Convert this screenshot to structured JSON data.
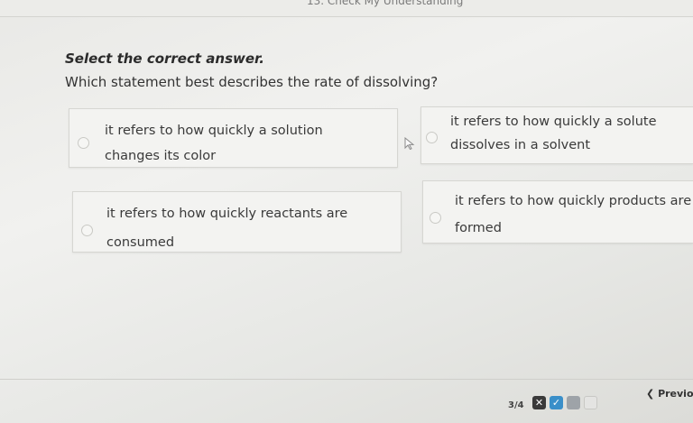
{
  "header": {
    "title": "13. Check My Understanding"
  },
  "instruction": "Select the correct answer.",
  "question": "Which statement best describes the rate of dissolving?",
  "options": [
    {
      "line1": "it refers to how quickly a solution",
      "line2": "changes its color"
    },
    {
      "line1": "it refers to how quickly a solute",
      "line2": "dissolves in a solvent"
    },
    {
      "line1": "it refers to how quickly reactants are",
      "line2": "consumed"
    },
    {
      "line1": "it refers to how quickly products are",
      "line2": "formed"
    }
  ],
  "footer": {
    "page_indicator": "3/4",
    "nav_wrong_icon": "x-icon",
    "nav_wrong_glyph": "✕",
    "nav_correct_icon": "check-icon",
    "nav_correct_glyph": "✓",
    "prev_label": "Previo",
    "prev_icon_glyph": "❮"
  },
  "colors": {
    "correct": "#3a8fc9",
    "wrong": "#3a3a3a",
    "current": "#9ea3a8"
  }
}
